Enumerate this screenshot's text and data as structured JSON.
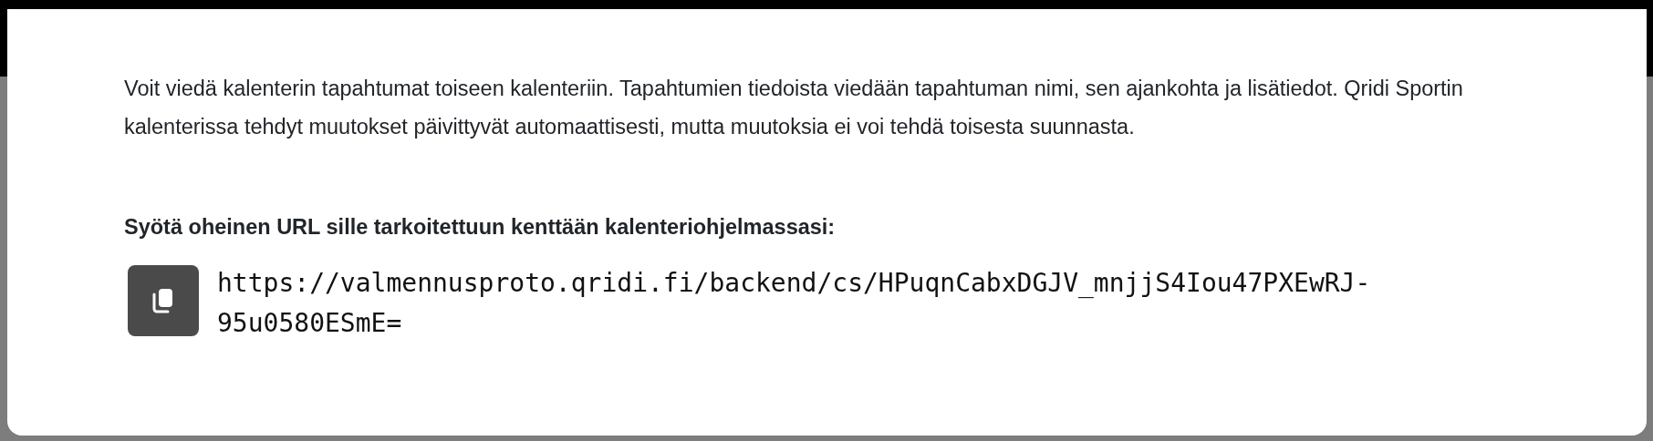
{
  "dialog": {
    "description": "Voit viedä kalenterin tapahtumat toiseen kalenteriin. Tapahtumien tiedoista viedään tapahtuman nimi, sen ajankohta ja lisätiedot. Qridi Sportin kalenterissa tehdyt muutokset päivittyvät automaattisesti, mutta muutoksia ei voi tehdä toisesta suunnasta.",
    "instruction": "Syötä oheinen URL sille tarkoitettuun kenttään kalenteriohjelmassasi:",
    "url": "https://valmennusproto.qridi.fi/backend/cs/HPuqnCabxDGJV_mnjjS4Iou47PXEwRJ-95u0580ESmE="
  }
}
